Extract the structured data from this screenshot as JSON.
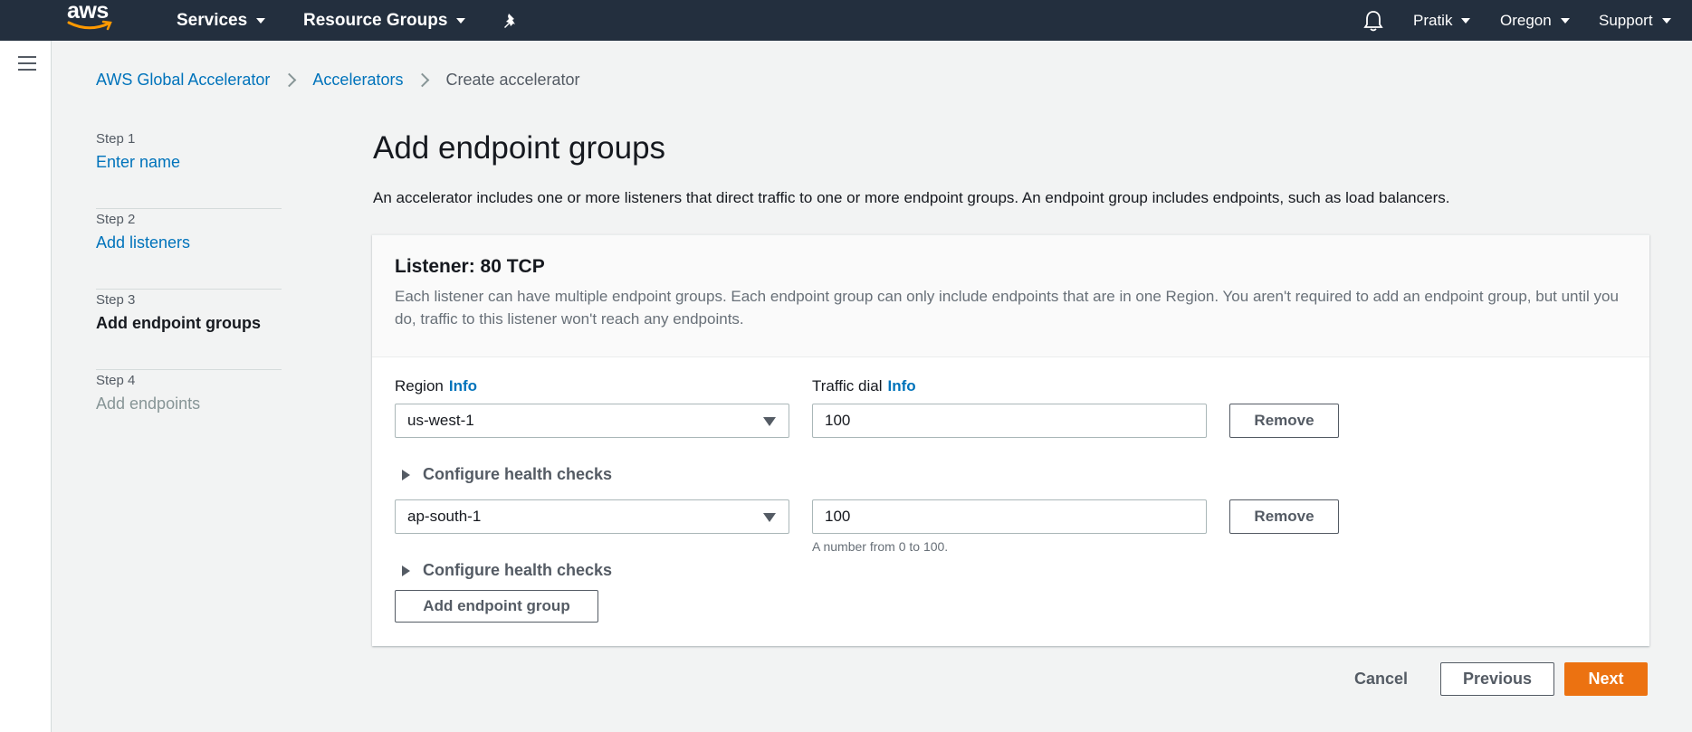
{
  "topnav": {
    "logo_text": "aws",
    "services": "Services",
    "resource_groups": "Resource Groups",
    "user": "Pratik",
    "region": "Oregon",
    "support": "Support"
  },
  "breadcrumb": {
    "root": "AWS Global Accelerator",
    "parent": "Accelerators",
    "current": "Create accelerator"
  },
  "steps": [
    {
      "num": "Step 1",
      "label": "Enter name",
      "state": "link"
    },
    {
      "num": "Step 2",
      "label": "Add listeners",
      "state": "link"
    },
    {
      "num": "Step 3",
      "label": "Add endpoint groups",
      "state": "active"
    },
    {
      "num": "Step 4",
      "label": "Add endpoints",
      "state": "disabled"
    }
  ],
  "page": {
    "title": "Add endpoint groups",
    "description": "An accelerator includes one or more listeners that direct traffic to one or more endpoint groups. An endpoint group includes endpoints, such as load balancers."
  },
  "listener": {
    "title": "Listener: 80 TCP",
    "description": "Each listener can have multiple endpoint groups. Each endpoint group can only include endpoints that are in one Region. You aren't required to add an endpoint group, but until you do, traffic to this listener won't reach any endpoints.",
    "region_label": "Region",
    "traffic_label": "Traffic dial",
    "info": "Info",
    "groups": [
      {
        "region": "us-west-1",
        "traffic": "100",
        "remove": "Remove",
        "health": "Configure health checks"
      },
      {
        "region": "ap-south-1",
        "traffic": "100",
        "remove": "Remove",
        "health": "Configure health checks"
      }
    ],
    "traffic_hint": "A number from 0 to 100.",
    "add_group": "Add endpoint group"
  },
  "footer": {
    "cancel": "Cancel",
    "previous": "Previous",
    "next": "Next"
  },
  "colors": {
    "nav_bg": "#232f3e",
    "link": "#0073bb",
    "primary": "#ec7211",
    "logo_smile": "#ff9900"
  }
}
